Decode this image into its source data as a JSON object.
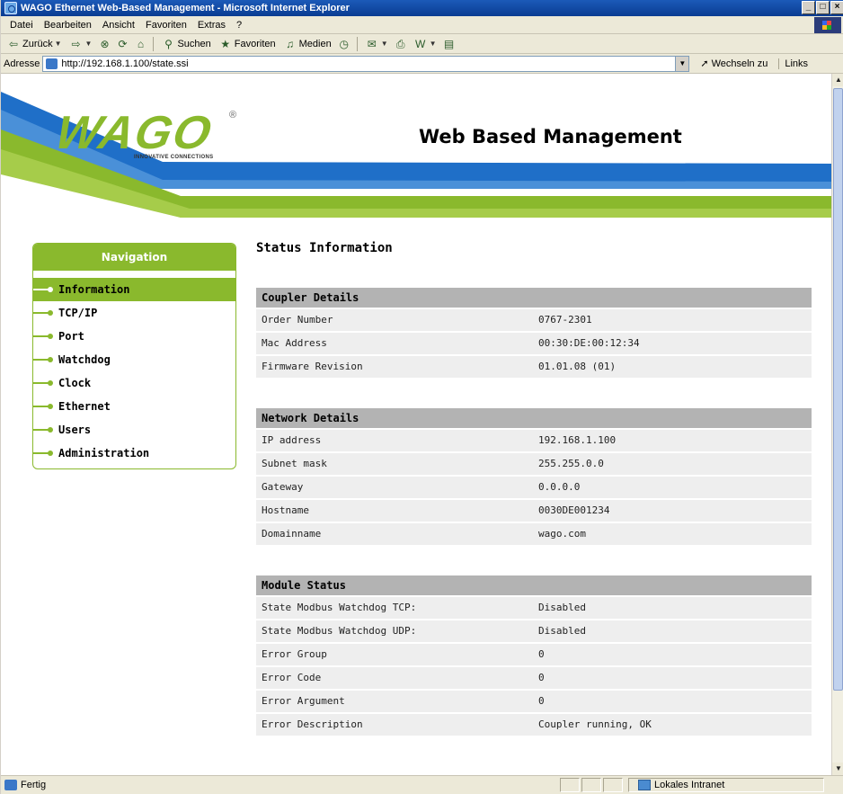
{
  "window": {
    "title": "WAGO Ethernet Web-Based Management - Microsoft Internet Explorer",
    "controls": [
      "_",
      "□",
      "×"
    ]
  },
  "menubar": [
    "Datei",
    "Bearbeiten",
    "Ansicht",
    "Favoriten",
    "Extras",
    "?"
  ],
  "toolbar": {
    "back_label": "Zurück",
    "search_label": "Suchen",
    "favorites_label": "Favoriten",
    "media_label": "Medien"
  },
  "addressbar": {
    "label": "Adresse",
    "url": "http://192.168.1.100/state.ssi",
    "go_label": "Wechseln zu",
    "links_label": "Links"
  },
  "header": {
    "logo_text": "WAGO",
    "logo_registered": "®",
    "logo_tagline": "INNOVATIVE CONNECTIONS",
    "title": "Web Based Management"
  },
  "navigation": {
    "heading": "Navigation",
    "items": [
      "Information",
      "TCP/IP",
      "Port",
      "Watchdog",
      "Clock",
      "Ethernet",
      "Users",
      "Administration"
    ],
    "active": "Information"
  },
  "content": {
    "page_title": "Status Information",
    "sections": [
      {
        "title": "Coupler Details",
        "rows": [
          [
            "Order Number",
            "0767-2301"
          ],
          [
            "Mac Address",
            "00:30:DE:00:12:34"
          ],
          [
            "Firmware Revision",
            "01.01.08 (01)"
          ]
        ]
      },
      {
        "title": "Network Details",
        "rows": [
          [
            "IP address",
            "192.168.1.100"
          ],
          [
            "Subnet mask",
            "255.255.0.0"
          ],
          [
            "Gateway",
            "0.0.0.0"
          ],
          [
            "Hostname",
            "0030DE001234"
          ],
          [
            "Domainname",
            "wago.com"
          ]
        ]
      },
      {
        "title": "Module Status",
        "rows": [
          [
            "State Modbus Watchdog TCP:",
            "Disabled"
          ],
          [
            "State Modbus Watchdog UDP:",
            "Disabled"
          ],
          [
            "Error Group",
            "0"
          ],
          [
            "Error Code",
            "0"
          ],
          [
            "Error Argument",
            "0"
          ],
          [
            "Error Description",
            "Coupler running, OK"
          ]
        ]
      }
    ]
  },
  "statusbar": {
    "status": "Fertig",
    "zone": "Lokales Intranet"
  },
  "colors": {
    "wago_green": "#8ab92d",
    "wago_blue": "#1f6fc8",
    "section_header_gray": "#b3b3b3",
    "row_gray": "#eeeeee"
  }
}
